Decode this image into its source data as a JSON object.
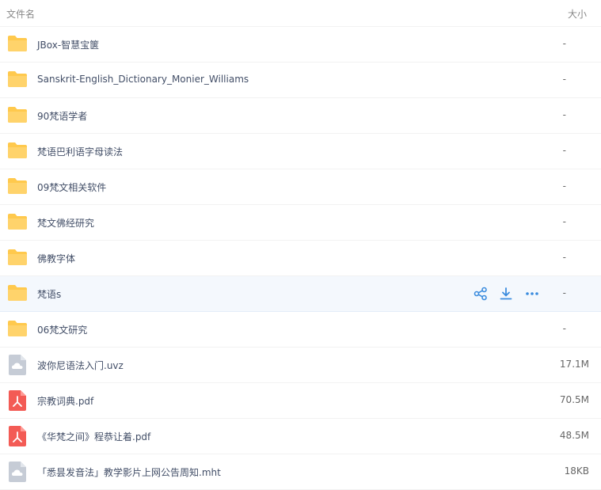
{
  "header": {
    "name_col": "文件名",
    "size_col": "大小"
  },
  "colors": {
    "folder": "#ffc94d",
    "pdf": "#f35b55",
    "generic": "#c6ccd6",
    "action": "#3b8cde"
  },
  "files": [
    {
      "name": "JBox-智慧宝箧",
      "size": "-",
      "type": "folder"
    },
    {
      "name": "Sanskrit-English_Dictionary_Monier_Williams",
      "size": "-",
      "type": "folder"
    },
    {
      "name": "90梵语学者",
      "size": "-",
      "type": "folder"
    },
    {
      "name": "梵语巴利语字母读法",
      "size": "-",
      "type": "folder"
    },
    {
      "name": "09梵文相关软件",
      "size": "-",
      "type": "folder"
    },
    {
      "name": "梵文佛经研究",
      "size": "-",
      "type": "folder"
    },
    {
      "name": "佛教字体",
      "size": "-",
      "type": "folder"
    },
    {
      "name": "梵语s",
      "size": "-",
      "type": "folder",
      "actions": [
        "share-icon",
        "download-icon",
        "more-icon"
      ]
    },
    {
      "name": "06梵文研究",
      "size": "-",
      "type": "folder"
    },
    {
      "name": "波你尼语法入门.uvz",
      "size": "17.1M",
      "type": "generic"
    },
    {
      "name": "宗教词典.pdf",
      "size": "70.5M",
      "type": "pdf"
    },
    {
      "name": "《华梵之间》程恭让着.pdf",
      "size": "48.5M",
      "type": "pdf"
    },
    {
      "name": "「悉昙发音法」教学影片上网公告周知.mht",
      "size": "18KB",
      "type": "generic"
    }
  ]
}
